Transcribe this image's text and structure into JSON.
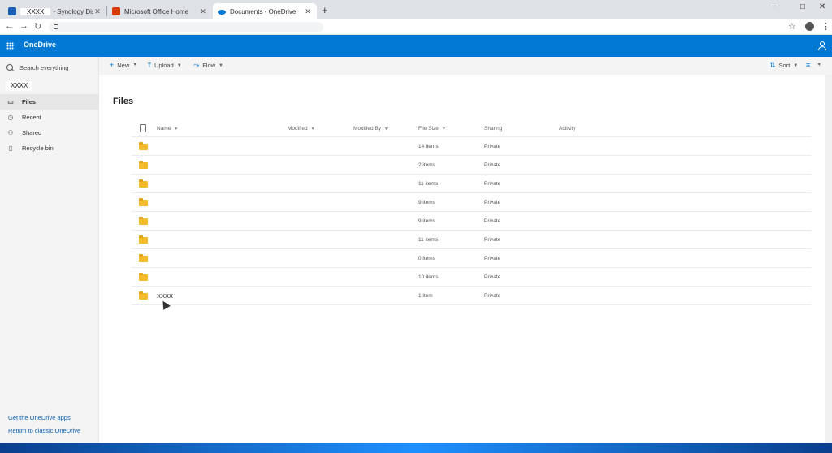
{
  "browser": {
    "tabs": [
      {
        "label_redacted": "XXXX",
        "label": "- Synology Disk",
        "favicon_color": "#1a5fb4"
      },
      {
        "label": "Microsoft Office Home",
        "favicon_color": "#d83b01"
      },
      {
        "label": "Documents - OneDrive",
        "favicon_color": "#0078d4",
        "active": true
      }
    ],
    "new_tab": "+",
    "window_controls": {
      "minimize": "−",
      "maximize": "□",
      "close": "✕"
    },
    "nav": {
      "back": "←",
      "forward": "→",
      "reload": "↻"
    },
    "star": "☆",
    "menu": "⋮"
  },
  "suite": {
    "brand": "OneDrive",
    "accent_color": "#0078d4"
  },
  "sidebar": {
    "search_placeholder": "Search everything",
    "account_name": "XXXX",
    "items": [
      {
        "label": "Files",
        "icon": "folder-icon",
        "active": true
      },
      {
        "label": "Recent",
        "icon": "clock-icon"
      },
      {
        "label": "Shared",
        "icon": "people-icon"
      },
      {
        "label": "Recycle bin",
        "icon": "trash-icon"
      }
    ],
    "links": [
      "Get the OneDrive apps",
      "Return to classic OneDrive"
    ]
  },
  "command_bar": {
    "new_label": "New",
    "upload_label": "Upload",
    "flow_label": "Flow",
    "sort_label": "Sort"
  },
  "main": {
    "title": "Files",
    "columns": {
      "name": "Name",
      "modified": "Modified",
      "modified_by": "Modified By",
      "file_size": "File Size",
      "sharing": "Sharing",
      "activity": "Activity"
    },
    "rows": [
      {
        "name": "",
        "size": "14 items",
        "sharing": "Private"
      },
      {
        "name": "",
        "size": "2 items",
        "sharing": "Private"
      },
      {
        "name": "",
        "size": "11 items",
        "sharing": "Private"
      },
      {
        "name": "",
        "size": "9 items",
        "sharing": "Private"
      },
      {
        "name": "",
        "size": "9 items",
        "sharing": "Private"
      },
      {
        "name": "",
        "size": "11 items",
        "sharing": "Private"
      },
      {
        "name": "",
        "size": "0 items",
        "sharing": "Private"
      },
      {
        "name": "",
        "size": "10 items",
        "sharing": "Private"
      },
      {
        "name": "XXXX",
        "size": "1 item",
        "sharing": "Private"
      }
    ]
  }
}
